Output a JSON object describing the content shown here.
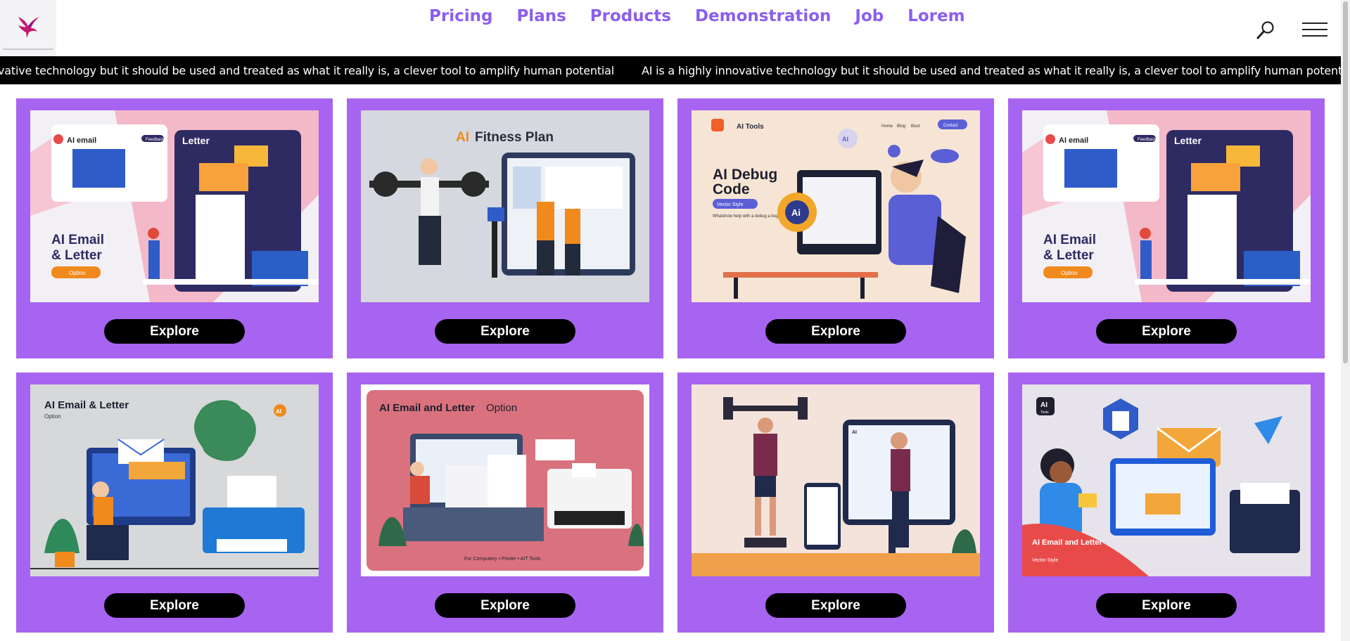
{
  "nav": {
    "items": [
      {
        "label": "Pricing"
      },
      {
        "label": "Plans"
      },
      {
        "label": "Products"
      },
      {
        "label": "Demonstration"
      },
      {
        "label": "Job"
      },
      {
        "label": "Lorem"
      }
    ]
  },
  "ticker": {
    "text_partial": "vative technology but it should be used and treated as what it really is, a clever tool to amplify human potential",
    "text": "AI is a highly innovative technology but it should be used and treated as what it really is, a clever tool to amplify human potential"
  },
  "icons": {
    "logo": "hummingbird-logo-icon",
    "search": "search-icon",
    "menu": "hamburger-menu-icon"
  },
  "colors": {
    "accent": "#8b5ef0",
    "card_bg": "#a764f0",
    "ticker_bg": "#000000",
    "button_bg": "#000000"
  },
  "cards": [
    {
      "button": "Explore",
      "title": "AI Email & Letter",
      "tag": "AI email",
      "side": "Letter",
      "option": "Option",
      "pill": "Feedback"
    },
    {
      "button": "Explore",
      "title_a": "AI",
      "title_b": "Fitness Plan"
    },
    {
      "button": "Explore",
      "title": "AI Debug Code",
      "brand": "AI Tools",
      "badge": "Vector Style",
      "sub": "Whatshow help with a debug a bug his code",
      "nav": [
        "Home",
        "Blog",
        "Bout"
      ],
      "navbtn": "Contact",
      "ai": "AI"
    },
    {
      "button": "Explore",
      "title": "AI Email & Letter",
      "tag": "AI email",
      "side": "Letter",
      "option": "Option",
      "pill": "Feedback"
    },
    {
      "button": "Explore",
      "title": "AI Email & Letter",
      "sub": "Option",
      "ai": "AI"
    },
    {
      "button": "Explore",
      "title": "AI Email and Letter",
      "title_sub": "Option",
      "footer": "For Computery • Printer • AIT Tools"
    },
    {
      "button": "Explore",
      "ai": "AI"
    },
    {
      "button": "Explore",
      "title": "AI Email and Letter",
      "sub": "Vector Style",
      "brand": "AI",
      "brand_sub": "Tools"
    }
  ]
}
